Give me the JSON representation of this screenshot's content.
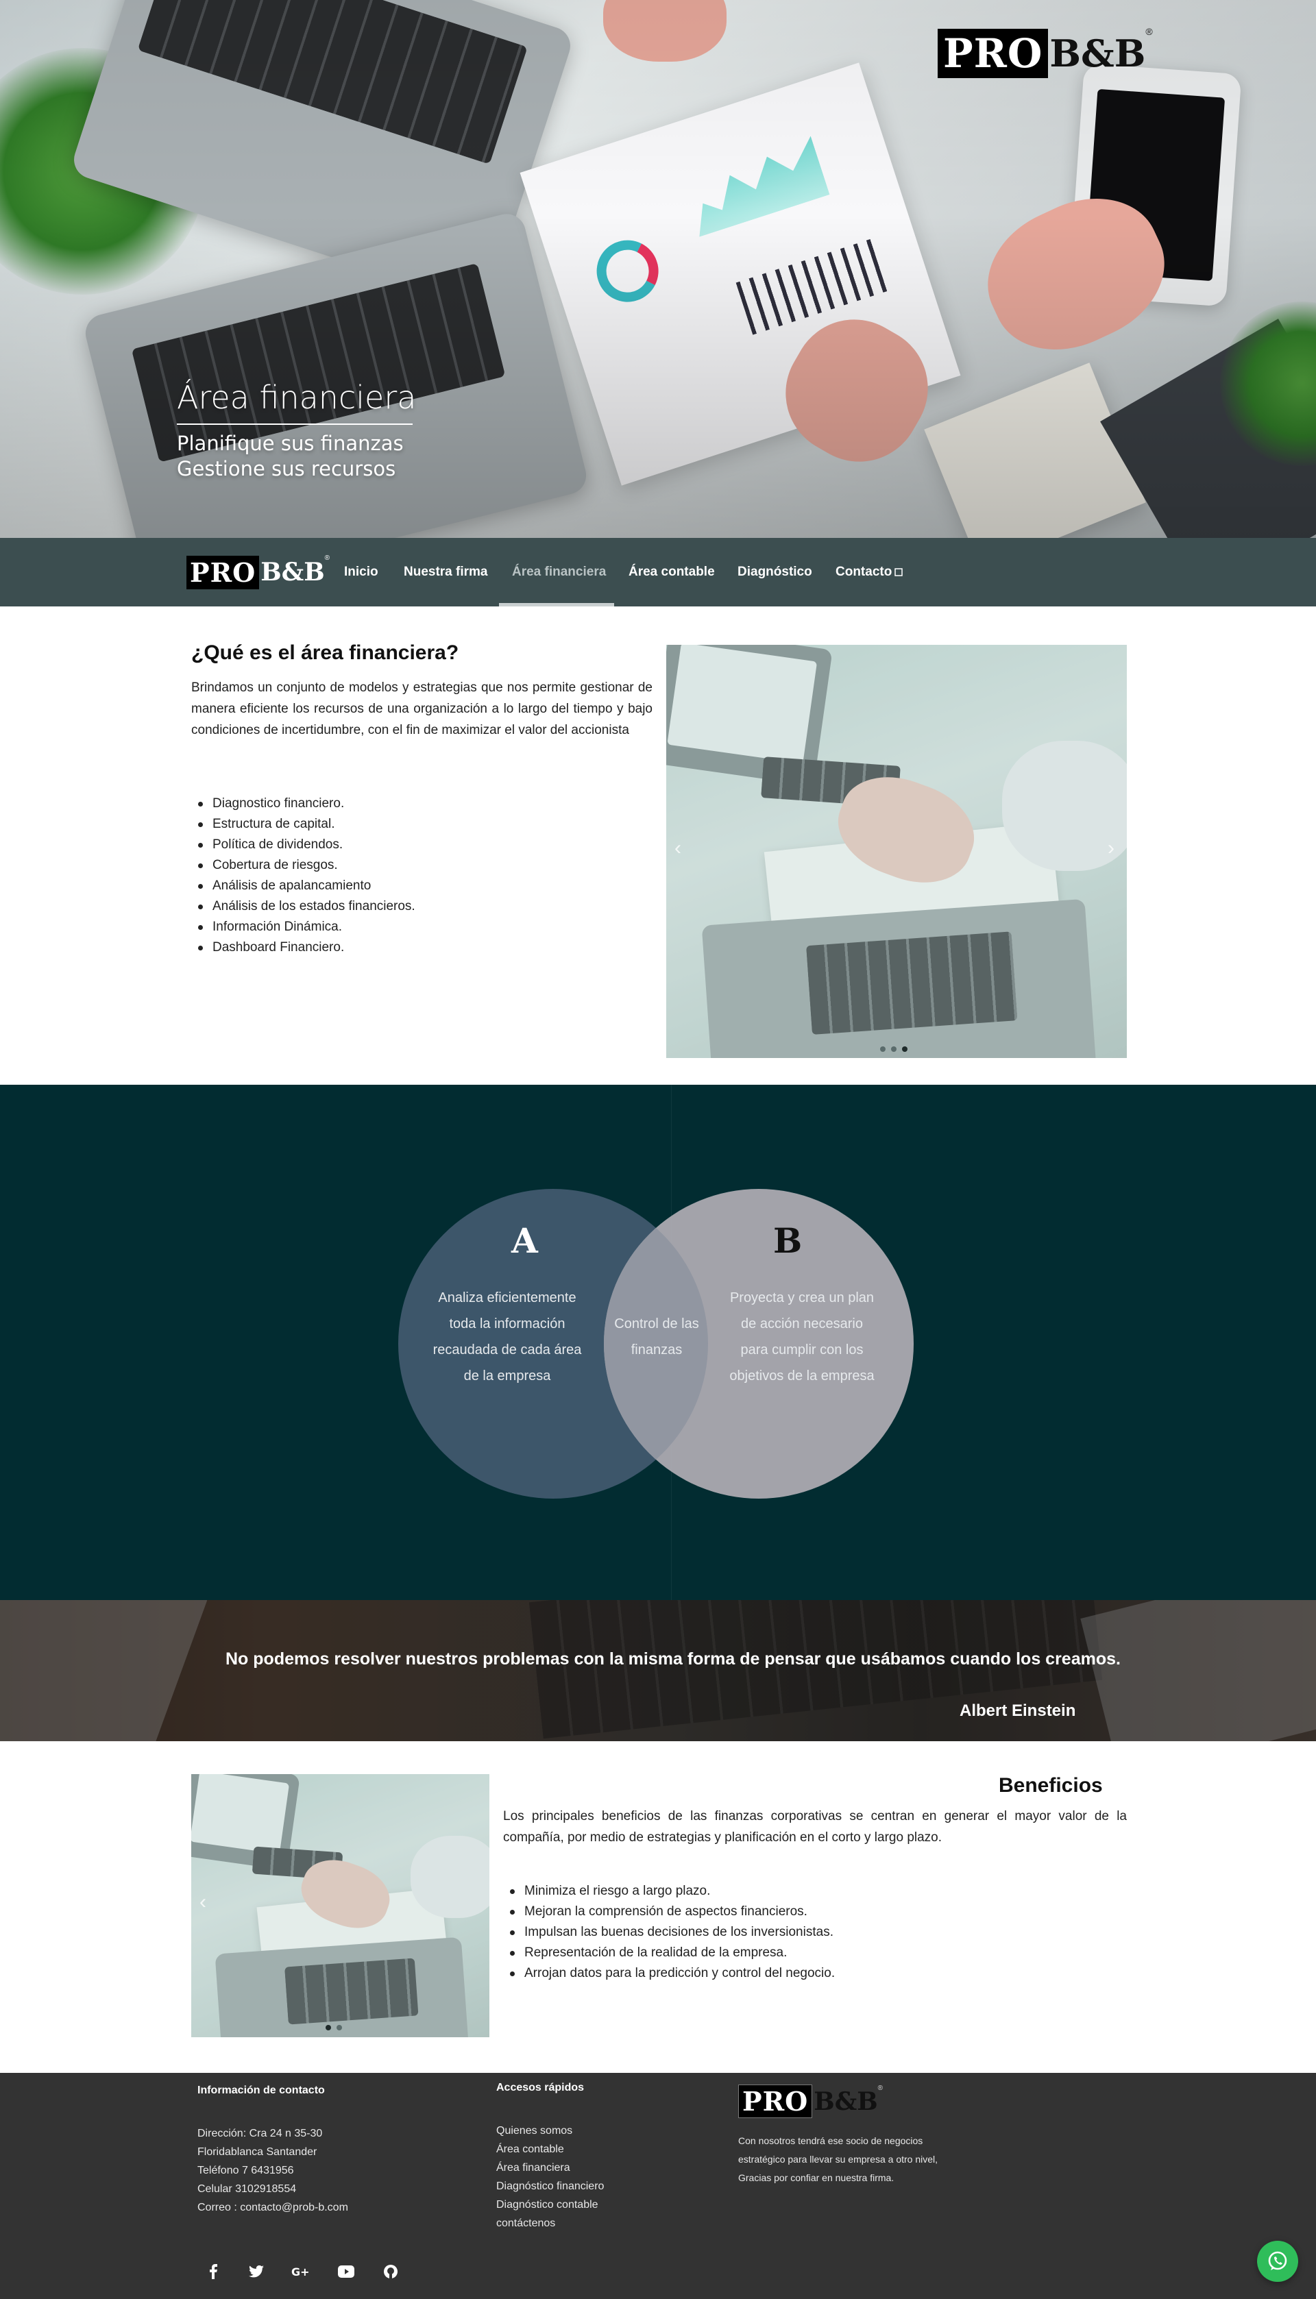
{
  "brand": {
    "pro": "PRO",
    "bb": "B&B",
    "registered": "®"
  },
  "hero": {
    "title": "Área financiera",
    "subtitle_1": "Planifique sus finanzas",
    "subtitle_2": "Gestione sus recursos"
  },
  "nav": {
    "items": [
      {
        "label": "Inicio"
      },
      {
        "label": "Nuestra firma"
      },
      {
        "label": "Área financiera"
      },
      {
        "label": "Área contable"
      },
      {
        "label": "Diagnóstico"
      },
      {
        "label": "Contacto"
      }
    ],
    "active_index": 2
  },
  "about": {
    "title": "¿Qué es el área financiera?",
    "text": "Brindamos un conjunto de modelos y estrategias que nos permite gestionar de manera eficiente los recursos de una organización a lo largo del tiempo y bajo condiciones de incertidumbre, con el fin de maximizar el valor del accionista",
    "bullets": [
      "Diagnostico financiero.",
      "Estructura de capital.",
      "Política de dividendos.",
      "Cobertura de riesgos.",
      "Análisis de apalancamiento",
      "Análisis de los estados financieros.",
      "Información Dinámica.",
      "Dashboard Financiero."
    ]
  },
  "venn": {
    "a_letter": "A",
    "a_text": [
      "Analiza eficientemente",
      "toda la información",
      "recaudada de cada área",
      "de la empresa"
    ],
    "b_letter": "B",
    "b_text": [
      "Proyecta y crea un plan",
      "de acción necesario",
      "para cumplir con los",
      "objetivos de la empresa"
    ],
    "center_text": [
      "Control de las",
      "finanzas"
    ]
  },
  "quote": {
    "text": "No podemos resolver nuestros problemas con la misma forma de pensar que usábamos cuando los creamos.",
    "author": "Albert Einstein"
  },
  "benefits": {
    "title": "Beneficios",
    "text": "Los principales beneficios de las finanzas corporativas se centran en generar el mayor valor de la compañía, por medio de estrategias y planificación en el corto y largo plazo.",
    "bullets": [
      "Minimiza el riesgo a largo plazo.",
      "Mejoran la comprensión de aspectos financieros.",
      "Impulsan las buenas decisiones de los inversionistas.",
      "Representación de la realidad de la empresa.",
      "Arrojan datos para la predicción y control del negocio."
    ]
  },
  "footer": {
    "contact_title": "Información de contacto",
    "contact_lines": [
      "Dirección: Cra 24 n 35-30",
      "Floridablanca Santander",
      "Teléfono 7 6431956",
      "Celular 3102918554",
      "Correo : contacto@prob-b.com"
    ],
    "links_title": "Accesos rápidos",
    "links": [
      "Quienes somos",
      "Área contable",
      "Área financiera",
      "Diagnóstico financiero",
      "Diagnóstico contable",
      "contáctenos"
    ],
    "about_text": [
      "Con nosotros tendrá ese socio de negocios",
      "estratégico para llevar su empresa a otro nivel,",
      "Gracias por confiar en nuestra firma."
    ],
    "social": [
      "facebook-icon",
      "twitter-icon",
      "google-plus-icon",
      "youtube-icon",
      "github-icon"
    ]
  },
  "colors": {
    "nav_bg": "#3c4e50",
    "venn_bg": "#022c31",
    "circle_a": "#3d566a",
    "circle_b": "#acaab1",
    "footer_bg": "#333333",
    "whatsapp": "#2fbd5a"
  }
}
